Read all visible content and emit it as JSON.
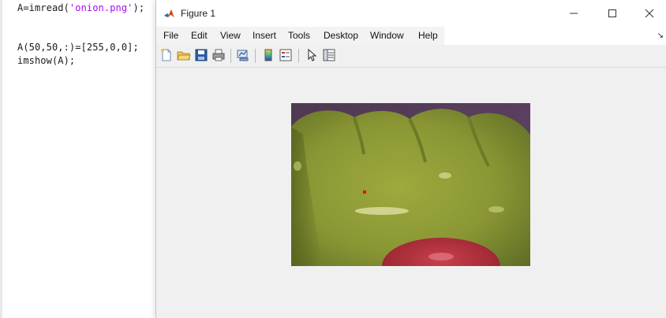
{
  "editor": {
    "lines": [
      {
        "prefix": "A=imread(",
        "string": "'onion.png'",
        "suffix": ");"
      },
      {
        "text": "A(50,50,:)=[255,0,0];"
      },
      {
        "text": "imshow(A);"
      }
    ]
  },
  "figure": {
    "title": "Figure 1",
    "menu": [
      "File",
      "Edit",
      "View",
      "Insert",
      "Tools",
      "Desktop",
      "Window",
      "Help"
    ],
    "toolbar_icons": [
      "new-figure-icon",
      "open-file-icon",
      "save-icon",
      "print-icon",
      "link-plot-icon",
      "insert-colorbar-icon",
      "insert-legend-icon",
      "edit-plot-icon",
      "property-inspector-icon"
    ],
    "image": {
      "name": "onion.png",
      "marked_pixel": {
        "row": 50,
        "col": 50,
        "rgb": [
          255,
          0,
          0
        ]
      }
    }
  },
  "colors": {
    "string_literal": "#a709f5",
    "marker": "#ff0000"
  }
}
